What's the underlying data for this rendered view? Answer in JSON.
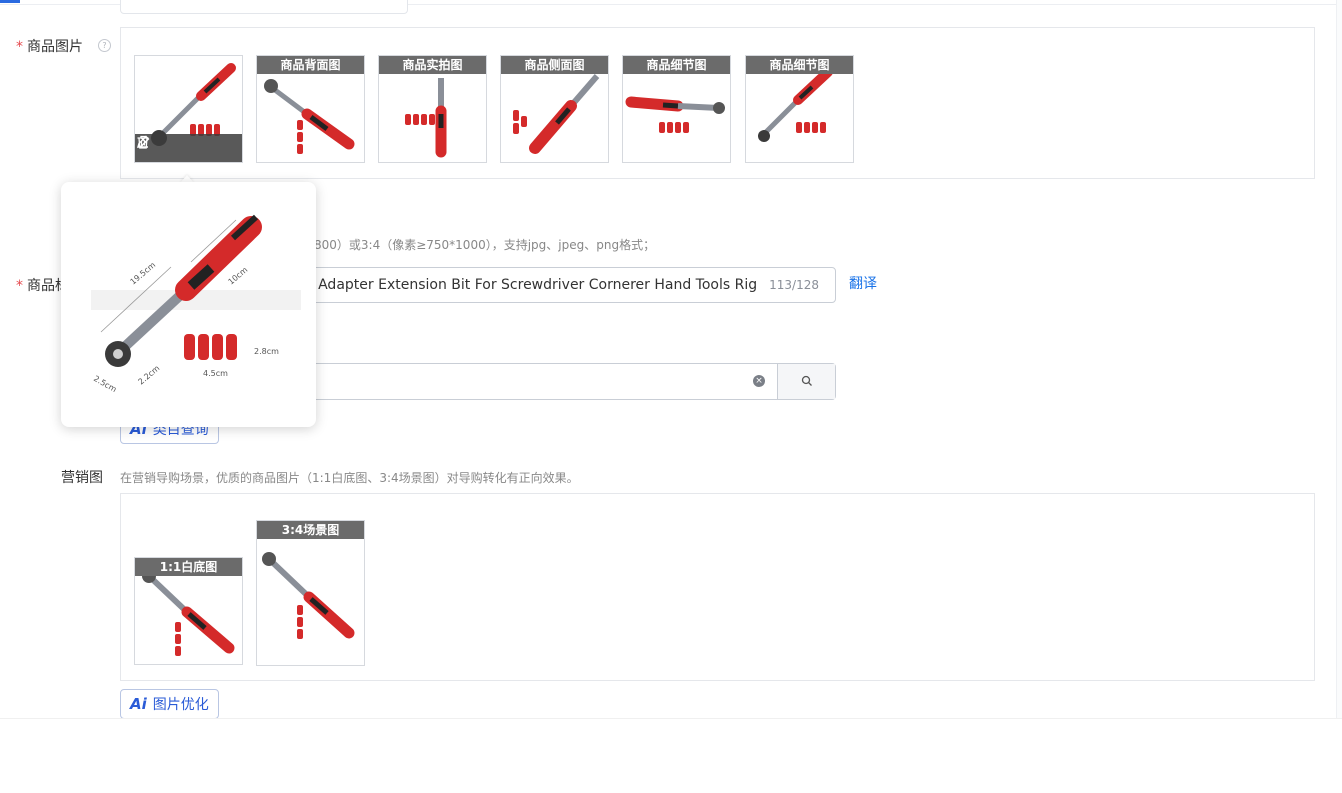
{
  "product_images": {
    "label": "商品图片",
    "required_mark": "*",
    "help_icon": "question-circle-icon",
    "thumbnails": [
      {
        "tag": ""
      },
      {
        "tag": "商品背面图"
      },
      {
        "tag": "商品实拍图"
      },
      {
        "tag": "商品侧面图"
      },
      {
        "tag": "商品细节图"
      },
      {
        "tag": "商品细节图"
      }
    ],
    "hover_actions": [
      "edit-icon",
      "delete-icon",
      "chevron-right-icon"
    ],
    "preview_labels": {
      "length": "19.5cm",
      "handle": "10cm",
      "bits_height": "2.8cm",
      "bits_width": "4.5cm",
      "head_a": "2.5cm",
      "head_b": "2.2cm"
    },
    "hint_suffix": "800）或3:4（像素≥750*1000），支持jpg、jpeg、png格式；"
  },
  "product_title": {
    "label_visible": "商品标",
    "required_mark": "*",
    "value_visible": "ill Adapter Extension Bit For Screwdriver Cornerer Hand Tools Rig",
    "counter": "113/128",
    "translate_link": "翻译"
  },
  "search": {
    "clear_icon": "clear-circle-icon",
    "button_icon": "search-icon"
  },
  "ai_category_button": {
    "label": "类目查询"
  },
  "marketing": {
    "label": "营销图",
    "hint": "在营销导购场景，优质的商品图片（1:1白底图、3:4场景图）对导购转化有正向效果。",
    "thumbnails": [
      {
        "tag": "1:1白底图"
      },
      {
        "tag": "3:4场景图"
      }
    ],
    "ai_optimize_button": {
      "label": "图片优化"
    }
  },
  "ai_mark": "Ai"
}
